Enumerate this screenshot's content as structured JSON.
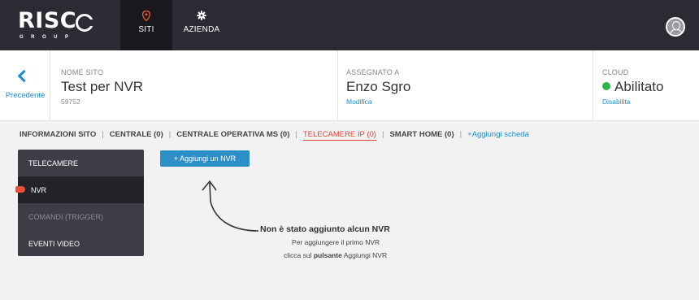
{
  "topbar": {
    "logo_text": "RISC",
    "logo_sub": "GROUP",
    "tabs": [
      {
        "label": "SITI",
        "icon": "map-pin-icon",
        "active": true
      },
      {
        "label": "AZIENDA",
        "icon": "gear-icon",
        "active": false
      }
    ],
    "avatar_icon": "user-avatar-icon"
  },
  "site_header": {
    "back_label": "Precedente",
    "site_name_label": "NOME SITO",
    "site_name": "Test per NVR",
    "site_id": "59752",
    "assigned_label": "ASSEGNATO A",
    "assigned_to": "Enzo Sgro",
    "assigned_action": "Modifica",
    "cloud_label": "CLOUD",
    "cloud_status": "Abilitato",
    "cloud_action": "Disabilita",
    "cloud_status_color": "#2fb34a"
  },
  "section_tabs": [
    {
      "label": "INFORMAZIONI SITO"
    },
    {
      "label": "CENTRALE (0)"
    },
    {
      "label": "CENTRALE OPERATIVA MS (0)"
    },
    {
      "label": "TELECAMERE IP (0)",
      "active": true
    },
    {
      "label": "SMART HOME (0)"
    },
    {
      "label": "+Aggiungi scheda"
    }
  ],
  "side_menu": [
    {
      "label": "TELECAMERE"
    },
    {
      "label": "NVR",
      "active": true
    },
    {
      "label": "COMANDI (TRIGGER)",
      "disabled": true
    },
    {
      "label": "EVENTI VIDEO"
    }
  ],
  "add_button_label": "+ Aggiungi un NVR",
  "empty_state": {
    "title": "Non è stato aggiunto alcun NVR",
    "line1": "Per aggiungere il primo NVR",
    "line2_prefix": "clicca sul ",
    "line2_bold": "pulsante",
    "line2_suffix": " Aggiungi NVR"
  },
  "colors": {
    "accent": "#1a8fd0",
    "button": "#2c8fc7",
    "active_tab": "#e0453a",
    "topbar": "#2b2b33"
  }
}
